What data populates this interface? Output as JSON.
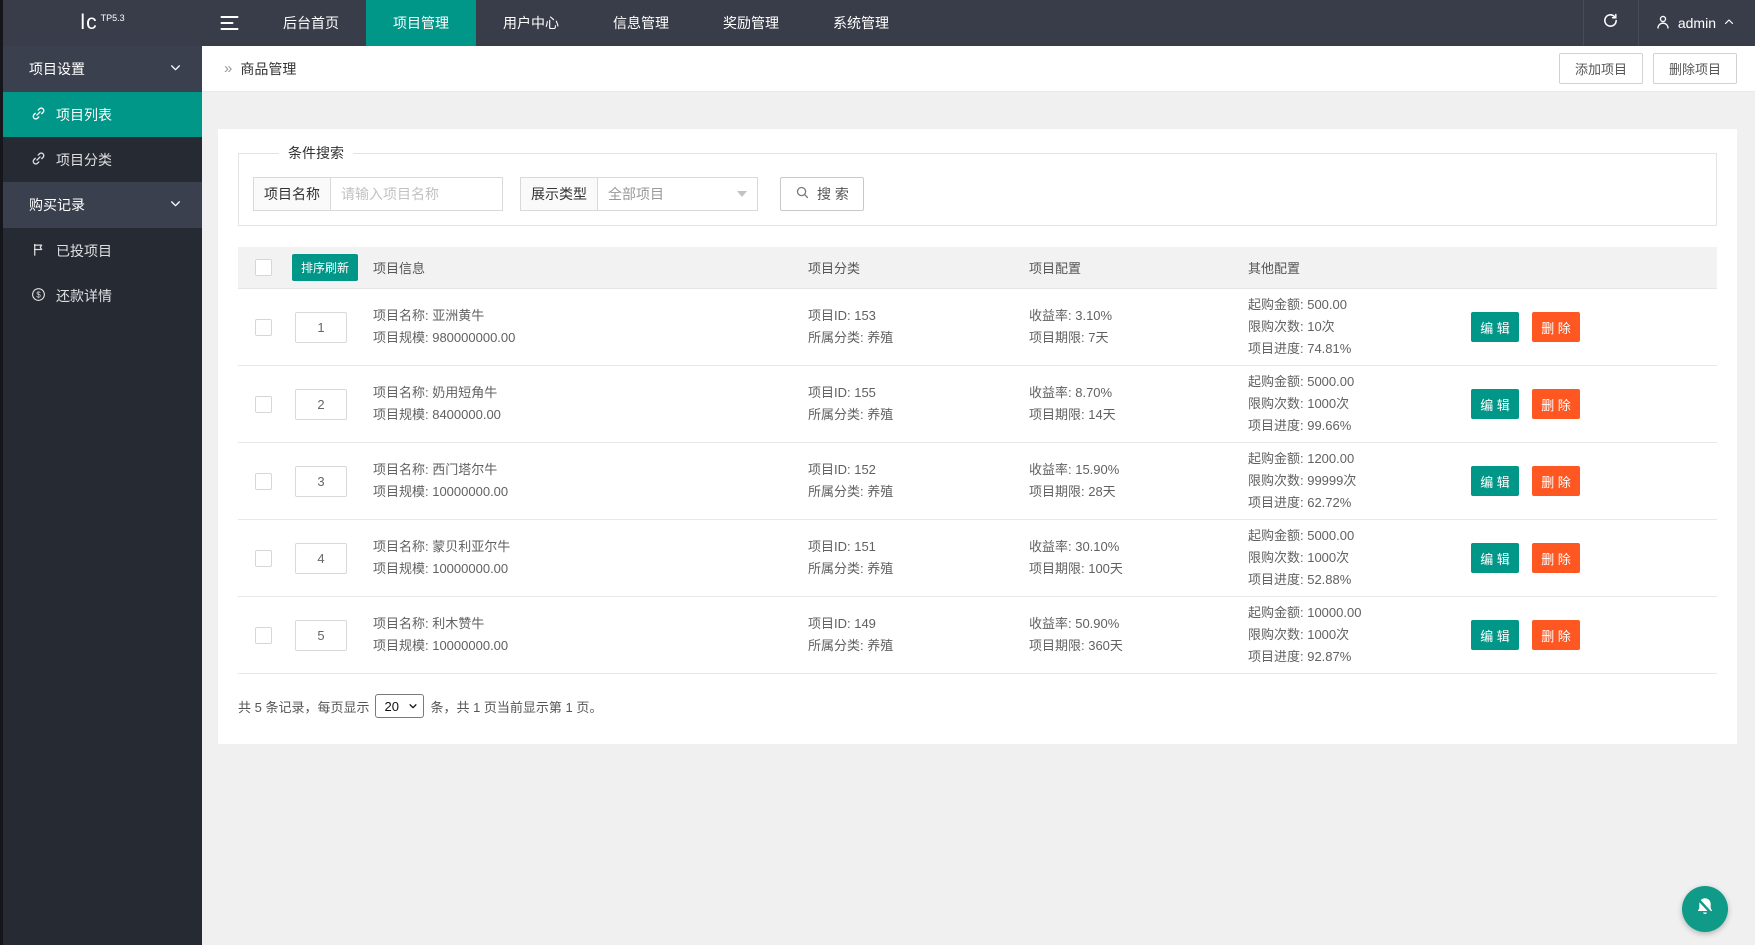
{
  "colors": {
    "accent": "#009688",
    "danger": "#FF5722",
    "dark": "#393D49"
  },
  "topbar": {
    "logo": "lc",
    "logo_version": "TP5.3",
    "nav_items": [
      {
        "label": "后台首页",
        "active": false
      },
      {
        "label": "项目管理",
        "active": true
      },
      {
        "label": "用户中心",
        "active": false
      },
      {
        "label": "信息管理",
        "active": false
      },
      {
        "label": "奖励管理",
        "active": false
      },
      {
        "label": "系统管理",
        "active": false
      }
    ],
    "username": "admin"
  },
  "sidebar": {
    "groups": [
      {
        "label": "项目设置",
        "items": [
          {
            "label": "项目列表",
            "icon": "link-icon",
            "active": true
          },
          {
            "label": "项目分类",
            "icon": "link-icon",
            "active": false
          }
        ]
      },
      {
        "label": "购买记录",
        "items": [
          {
            "label": "已投项目",
            "icon": "flag-icon",
            "active": false
          },
          {
            "label": "还款详情",
            "icon": "money-icon",
            "active": false
          }
        ]
      }
    ]
  },
  "breadcrumb": {
    "separator": "»",
    "title": "商品管理"
  },
  "toolbar": {
    "add_label": "添加项目",
    "delete_label": "删除项目"
  },
  "search": {
    "legend": "条件搜索",
    "name_label": "项目名称",
    "name_placeholder": "请输入项目名称",
    "type_label": "展示类型",
    "type_value": "全部项目",
    "search_label": "搜 索"
  },
  "table": {
    "sort_refresh_label": "排序刷新",
    "headers": {
      "info": "项目信息",
      "category": "项目分类",
      "config": "项目配置",
      "other": "其他配置"
    },
    "edit_label": "编 辑",
    "delete_label": "删 除",
    "rows": [
      {
        "sort": "1",
        "info_name": "项目名称: 亚洲黄牛",
        "info_scale": "项目规模: 980000000.00",
        "cat_id": "项目ID: 153",
        "cat_class": "所属分类: 养殖",
        "cfg_rate": "收益率: 3.10%",
        "cfg_term": "项目期限: 7天",
        "other_min": "起购金额: 500.00",
        "other_limit": "限购次数: 10次",
        "other_progress": "项目进度: 74.81%"
      },
      {
        "sort": "2",
        "info_name": "项目名称: 奶用短角牛",
        "info_scale": "项目规模: 8400000.00",
        "cat_id": "项目ID: 155",
        "cat_class": "所属分类: 养殖",
        "cfg_rate": "收益率: 8.70%",
        "cfg_term": "项目期限: 14天",
        "other_min": "起购金额: 5000.00",
        "other_limit": "限购次数: 1000次",
        "other_progress": "项目进度: 99.66%"
      },
      {
        "sort": "3",
        "info_name": "项目名称: 西门塔尔牛",
        "info_scale": "项目规模: 10000000.00",
        "cat_id": "项目ID: 152",
        "cat_class": "所属分类: 养殖",
        "cfg_rate": "收益率: 15.90%",
        "cfg_term": "项目期限: 28天",
        "other_min": "起购金额: 1200.00",
        "other_limit": "限购次数: 99999次",
        "other_progress": "项目进度: 62.72%"
      },
      {
        "sort": "4",
        "info_name": "项目名称: 蒙贝利亚尔牛",
        "info_scale": "项目规模: 10000000.00",
        "cat_id": "项目ID: 151",
        "cat_class": "所属分类: 养殖",
        "cfg_rate": "收益率: 30.10%",
        "cfg_term": "项目期限: 100天",
        "other_min": "起购金额: 5000.00",
        "other_limit": "限购次数: 1000次",
        "other_progress": "项目进度: 52.88%"
      },
      {
        "sort": "5",
        "info_name": "项目名称: 利木赞牛",
        "info_scale": "项目规模: 10000000.00",
        "cat_id": "项目ID: 149",
        "cat_class": "所属分类: 养殖",
        "cfg_rate": "收益率: 50.90%",
        "cfg_term": "项目期限: 360天",
        "other_min": "起购金额: 10000.00",
        "other_limit": "限购次数: 1000次",
        "other_progress": "项目进度: 92.87%"
      }
    ]
  },
  "pagination": {
    "prefix": "共 5 条记录，每页显示",
    "page_size": "20",
    "suffix": "条，共 1 页当前显示第 1 页。"
  }
}
